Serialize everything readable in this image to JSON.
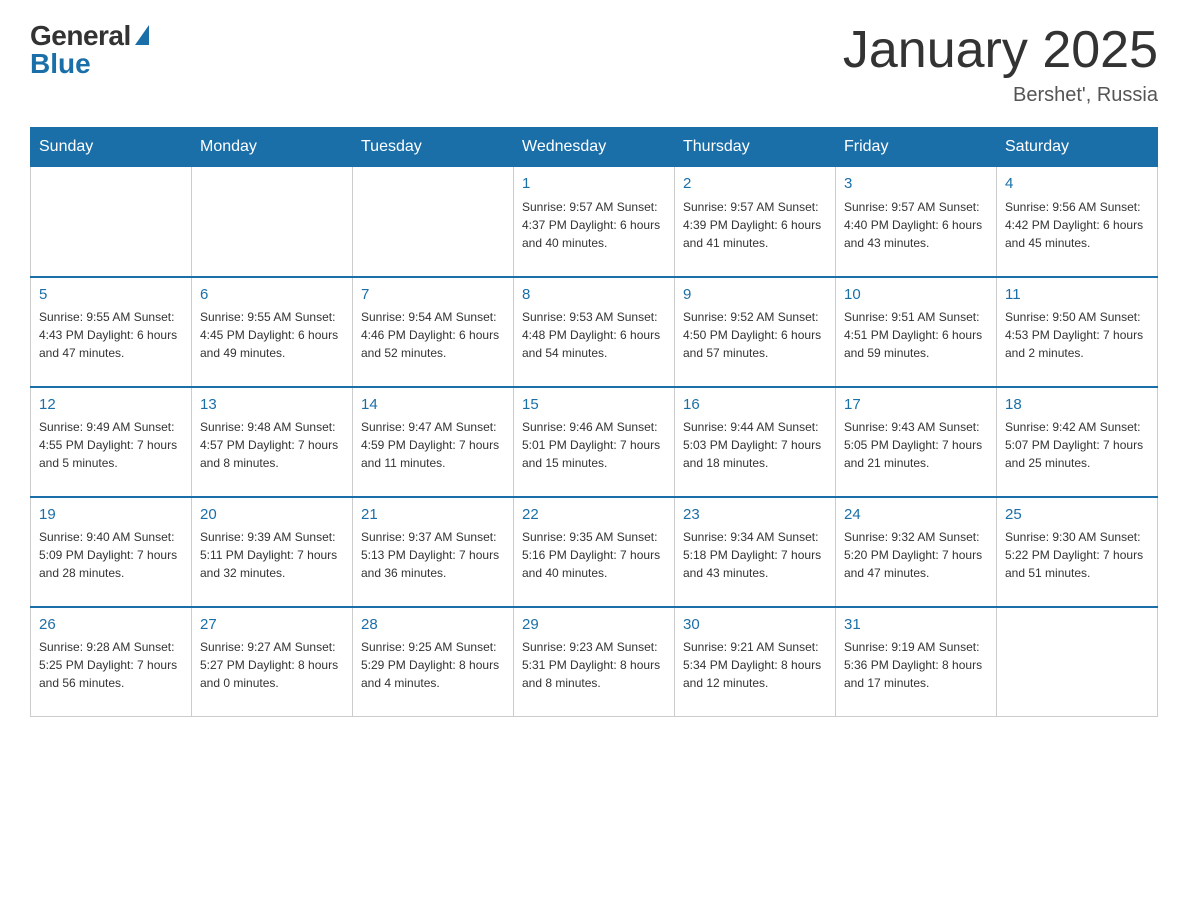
{
  "header": {
    "logo_general": "General",
    "logo_blue": "Blue",
    "month_title": "January 2025",
    "location": "Bershet', Russia"
  },
  "days_of_week": [
    "Sunday",
    "Monday",
    "Tuesday",
    "Wednesday",
    "Thursday",
    "Friday",
    "Saturday"
  ],
  "weeks": [
    [
      {
        "day": "",
        "info": ""
      },
      {
        "day": "",
        "info": ""
      },
      {
        "day": "",
        "info": ""
      },
      {
        "day": "1",
        "info": "Sunrise: 9:57 AM\nSunset: 4:37 PM\nDaylight: 6 hours\nand 40 minutes."
      },
      {
        "day": "2",
        "info": "Sunrise: 9:57 AM\nSunset: 4:39 PM\nDaylight: 6 hours\nand 41 minutes."
      },
      {
        "day": "3",
        "info": "Sunrise: 9:57 AM\nSunset: 4:40 PM\nDaylight: 6 hours\nand 43 minutes."
      },
      {
        "day": "4",
        "info": "Sunrise: 9:56 AM\nSunset: 4:42 PM\nDaylight: 6 hours\nand 45 minutes."
      }
    ],
    [
      {
        "day": "5",
        "info": "Sunrise: 9:55 AM\nSunset: 4:43 PM\nDaylight: 6 hours\nand 47 minutes."
      },
      {
        "day": "6",
        "info": "Sunrise: 9:55 AM\nSunset: 4:45 PM\nDaylight: 6 hours\nand 49 minutes."
      },
      {
        "day": "7",
        "info": "Sunrise: 9:54 AM\nSunset: 4:46 PM\nDaylight: 6 hours\nand 52 minutes."
      },
      {
        "day": "8",
        "info": "Sunrise: 9:53 AM\nSunset: 4:48 PM\nDaylight: 6 hours\nand 54 minutes."
      },
      {
        "day": "9",
        "info": "Sunrise: 9:52 AM\nSunset: 4:50 PM\nDaylight: 6 hours\nand 57 minutes."
      },
      {
        "day": "10",
        "info": "Sunrise: 9:51 AM\nSunset: 4:51 PM\nDaylight: 6 hours\nand 59 minutes."
      },
      {
        "day": "11",
        "info": "Sunrise: 9:50 AM\nSunset: 4:53 PM\nDaylight: 7 hours\nand 2 minutes."
      }
    ],
    [
      {
        "day": "12",
        "info": "Sunrise: 9:49 AM\nSunset: 4:55 PM\nDaylight: 7 hours\nand 5 minutes."
      },
      {
        "day": "13",
        "info": "Sunrise: 9:48 AM\nSunset: 4:57 PM\nDaylight: 7 hours\nand 8 minutes."
      },
      {
        "day": "14",
        "info": "Sunrise: 9:47 AM\nSunset: 4:59 PM\nDaylight: 7 hours\nand 11 minutes."
      },
      {
        "day": "15",
        "info": "Sunrise: 9:46 AM\nSunset: 5:01 PM\nDaylight: 7 hours\nand 15 minutes."
      },
      {
        "day": "16",
        "info": "Sunrise: 9:44 AM\nSunset: 5:03 PM\nDaylight: 7 hours\nand 18 minutes."
      },
      {
        "day": "17",
        "info": "Sunrise: 9:43 AM\nSunset: 5:05 PM\nDaylight: 7 hours\nand 21 minutes."
      },
      {
        "day": "18",
        "info": "Sunrise: 9:42 AM\nSunset: 5:07 PM\nDaylight: 7 hours\nand 25 minutes."
      }
    ],
    [
      {
        "day": "19",
        "info": "Sunrise: 9:40 AM\nSunset: 5:09 PM\nDaylight: 7 hours\nand 28 minutes."
      },
      {
        "day": "20",
        "info": "Sunrise: 9:39 AM\nSunset: 5:11 PM\nDaylight: 7 hours\nand 32 minutes."
      },
      {
        "day": "21",
        "info": "Sunrise: 9:37 AM\nSunset: 5:13 PM\nDaylight: 7 hours\nand 36 minutes."
      },
      {
        "day": "22",
        "info": "Sunrise: 9:35 AM\nSunset: 5:16 PM\nDaylight: 7 hours\nand 40 minutes."
      },
      {
        "day": "23",
        "info": "Sunrise: 9:34 AM\nSunset: 5:18 PM\nDaylight: 7 hours\nand 43 minutes."
      },
      {
        "day": "24",
        "info": "Sunrise: 9:32 AM\nSunset: 5:20 PM\nDaylight: 7 hours\nand 47 minutes."
      },
      {
        "day": "25",
        "info": "Sunrise: 9:30 AM\nSunset: 5:22 PM\nDaylight: 7 hours\nand 51 minutes."
      }
    ],
    [
      {
        "day": "26",
        "info": "Sunrise: 9:28 AM\nSunset: 5:25 PM\nDaylight: 7 hours\nand 56 minutes."
      },
      {
        "day": "27",
        "info": "Sunrise: 9:27 AM\nSunset: 5:27 PM\nDaylight: 8 hours\nand 0 minutes."
      },
      {
        "day": "28",
        "info": "Sunrise: 9:25 AM\nSunset: 5:29 PM\nDaylight: 8 hours\nand 4 minutes."
      },
      {
        "day": "29",
        "info": "Sunrise: 9:23 AM\nSunset: 5:31 PM\nDaylight: 8 hours\nand 8 minutes."
      },
      {
        "day": "30",
        "info": "Sunrise: 9:21 AM\nSunset: 5:34 PM\nDaylight: 8 hours\nand 12 minutes."
      },
      {
        "day": "31",
        "info": "Sunrise: 9:19 AM\nSunset: 5:36 PM\nDaylight: 8 hours\nand 17 minutes."
      },
      {
        "day": "",
        "info": ""
      }
    ]
  ]
}
